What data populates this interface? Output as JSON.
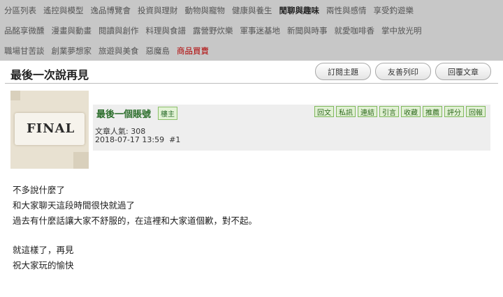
{
  "nav": {
    "row1": [
      {
        "label": "分區列表",
        "style": ""
      },
      {
        "label": "遙控與模型",
        "style": ""
      },
      {
        "label": "逸品博覽會",
        "style": ""
      },
      {
        "label": "投資與理財",
        "style": ""
      },
      {
        "label": "動物與寵物",
        "style": ""
      },
      {
        "label": "健康與養生",
        "style": ""
      },
      {
        "label": "閒聊與趣味",
        "style": "bold"
      },
      {
        "label": "兩性與感情",
        "style": ""
      },
      {
        "label": "享受釣遊樂",
        "style": ""
      }
    ],
    "row2": [
      {
        "label": "品酩享微醺",
        "style": ""
      },
      {
        "label": "漫畫與動畫",
        "style": ""
      },
      {
        "label": "閱讀與創作",
        "style": ""
      },
      {
        "label": "料理與食譜",
        "style": ""
      },
      {
        "label": "露營野炊樂",
        "style": ""
      },
      {
        "label": "軍事迷基地",
        "style": ""
      },
      {
        "label": "新聞與時事",
        "style": ""
      },
      {
        "label": "就愛咖啡香",
        "style": ""
      },
      {
        "label": "掌中放光明",
        "style": ""
      }
    ],
    "row3": [
      {
        "label": "職場甘苦談",
        "style": ""
      },
      {
        "label": "創業夢想家",
        "style": ""
      },
      {
        "label": "旅遊與美食",
        "style": ""
      },
      {
        "label": "惡魔島",
        "style": ""
      },
      {
        "label": "商品買賣",
        "style": "red"
      }
    ]
  },
  "topic": {
    "title": "最後一次說再見",
    "buttons": [
      "訂閱主題",
      "友善列印",
      "回覆文章"
    ]
  },
  "post": {
    "image_text": "FINAL",
    "author": "最後一個賬號",
    "role_badge": "樓主",
    "popularity": "文章人氣: 308",
    "timestamp": "2018-07-17 13:59",
    "floor": "#1",
    "actions": [
      "回文",
      "私訊",
      "連結",
      "引言",
      "收藏",
      "推薦",
      "評分",
      "回報"
    ],
    "content": [
      "不多說什麼了",
      "和大家聊天這段時間很快就過了",
      "過去有什麼話讓大家不舒服的，在這裡和大家道個歉，對不起。",
      "就這樣了，再見",
      "祝大家玩的愉快"
    ]
  }
}
